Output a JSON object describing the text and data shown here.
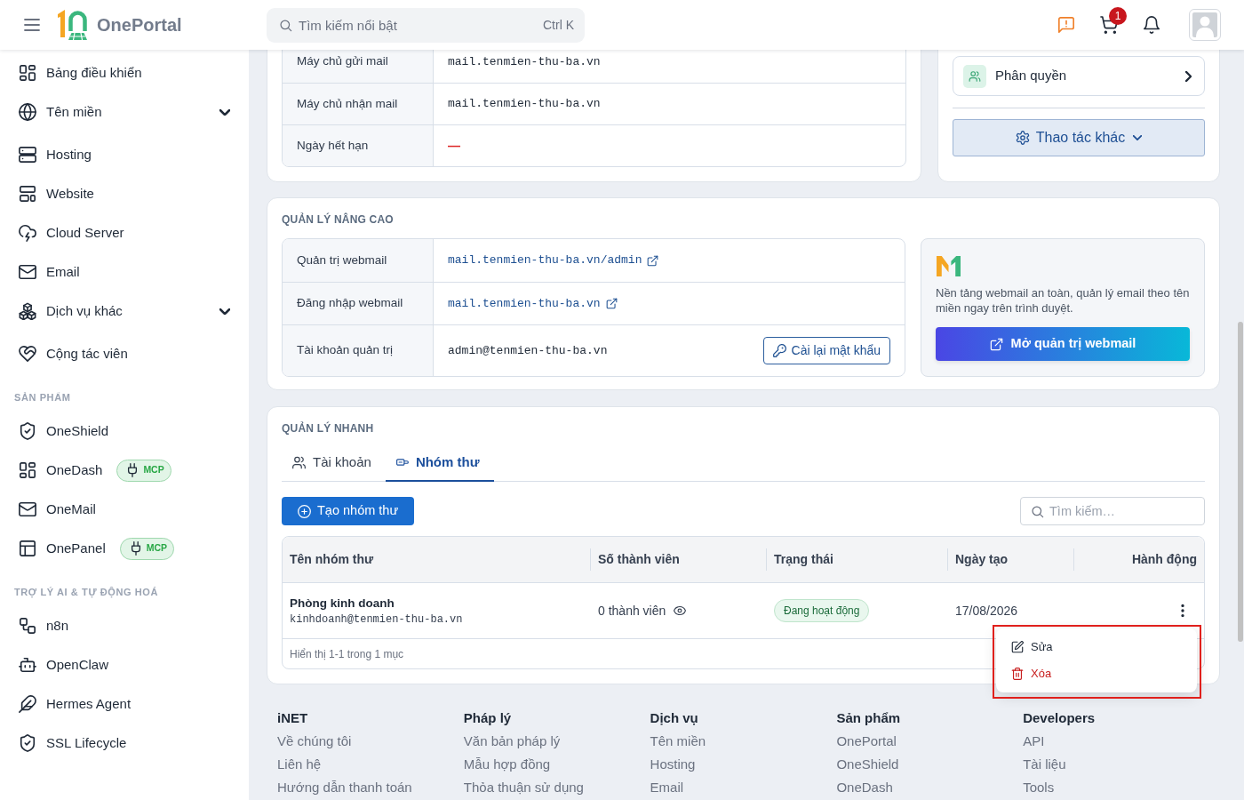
{
  "header": {
    "app_name": "OnePortal",
    "search": {
      "placeholder": "Tìm kiếm nổi bật",
      "shortcut": "Ctrl K"
    },
    "cart_count": "1"
  },
  "sidebar": {
    "sections": [
      {
        "items": [
          {
            "label": "Bảng điều khiển"
          },
          {
            "label": "Tên miền",
            "expanded": false
          },
          {
            "label": "Hosting"
          },
          {
            "label": "Website"
          },
          {
            "label": "Cloud Server"
          },
          {
            "label": "Email"
          },
          {
            "label": "Dịch vụ khác",
            "expanded": false
          },
          {
            "label": "Cộng tác viên"
          }
        ]
      },
      {
        "title": "SẢN PHẨM",
        "items": [
          {
            "label": "OneShield"
          },
          {
            "label": "OneDash",
            "badge": "MCP"
          },
          {
            "label": "OneMail"
          },
          {
            "label": "OnePanel",
            "badge": "MCP"
          }
        ]
      },
      {
        "title": "TRỢ LÝ AI & TỰ ĐỘNG HOÁ",
        "items": [
          {
            "label": "n8n"
          },
          {
            "label": "OpenClaw"
          },
          {
            "label": "Hermes Agent"
          },
          {
            "label": "SSL Lifecycle"
          }
        ]
      }
    ]
  },
  "mail_servers": {
    "rows": [
      {
        "label": "Máy chủ gửi mail",
        "value": "mail.tenmien-thu-ba.vn",
        "kind": "text"
      },
      {
        "label": "Máy chủ nhận mail",
        "value": "mail.tenmien-thu-ba.vn",
        "kind": "text"
      },
      {
        "label": "Ngày hết hạn",
        "value": "—",
        "kind": "missing"
      }
    ]
  },
  "side_actions": {
    "permissions": "Phân quyền",
    "more_actions": "Thao tác khác"
  },
  "advanced": {
    "title": "QUẢN LÝ NÂNG CAO",
    "rows": [
      {
        "label": "Quản trị webmail",
        "value": "mail.tenmien-thu-ba.vn/admin",
        "kind": "link"
      },
      {
        "label": "Đăng nhập webmail",
        "value": "mail.tenmien-thu-ba.vn",
        "kind": "link"
      },
      {
        "label": "Tài khoản quản trị",
        "value": "admin@tenmien-thu-ba.vn",
        "kind": "text",
        "action": "Cài lại mật khẩu"
      }
    ],
    "promo": {
      "description": "Nền tảng webmail an toàn, quản lý email theo tên miền ngay trên trình duyệt.",
      "button": "Mở quản trị webmail"
    }
  },
  "quick": {
    "title": "QUẢN LÝ NHANH",
    "tabs": [
      {
        "label": "Tài khoản",
        "selected": false
      },
      {
        "label": "Nhóm thư",
        "selected": true
      }
    ],
    "create_button": "Tạo nhóm thư",
    "search_placeholder": "Tìm kiếm…",
    "table": {
      "columns": [
        "Tên nhóm thư",
        "Số thành viên",
        "Trạng thái",
        "Ngày tạo",
        "Hành động"
      ],
      "rows": [
        {
          "name": "Phòng kinh doanh",
          "email": "kinhdoanh@tenmien-thu-ba.vn",
          "members": "0 thành viên",
          "status": "Đang hoạt động",
          "created": "17/08/2026"
        }
      ],
      "summary": "Hiển thị 1-1 trong 1 mục"
    },
    "action_menu": {
      "open": true,
      "highlighted": true,
      "items": [
        {
          "label": "Sửa",
          "kind": "edit"
        },
        {
          "label": "Xóa",
          "kind": "delete"
        }
      ]
    }
  },
  "footer": {
    "columns": [
      {
        "title": "iNET",
        "links": [
          "Về chúng tôi",
          "Liên hệ",
          "Hướng dẫn thanh toán"
        ]
      },
      {
        "title": "Pháp lý",
        "links": [
          "Văn bản pháp lý",
          "Mẫu hợp đồng",
          "Thỏa thuận sử dụng"
        ]
      },
      {
        "title": "Dịch vụ",
        "links": [
          "Tên miền",
          "Hosting",
          "Email"
        ]
      },
      {
        "title": "Sản phẩm",
        "links": [
          "OnePortal",
          "OneShield",
          "OneDash"
        ]
      },
      {
        "title": "Developers",
        "links": [
          "API",
          "Tài liệu",
          "Tools"
        ]
      }
    ]
  }
}
